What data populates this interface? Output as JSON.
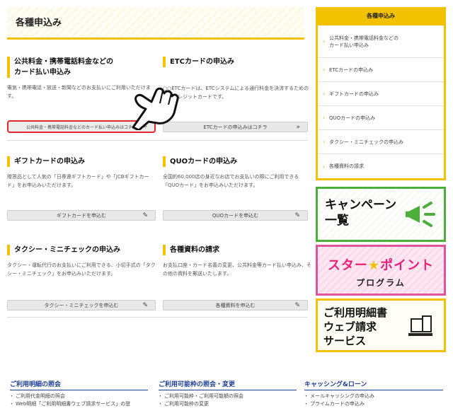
{
  "header": {
    "title": "各種申込み"
  },
  "cards": [
    {
      "title": "公共料金・携帯電話料金などの\nカード払い申込み",
      "desc": "電気・携帯電話・放送・新聞などのお支払いにご利用いただけます。",
      "button": "公共料金・携帯電話料金などのカード払い申込みはコチラ",
      "icon": "double-chevron-right"
    },
    {
      "title": "ETCカードの申込み",
      "desc": "○○ETCカードは、ETCシステムによる通行料金を決済するための専用クレジットカードです。",
      "button": "ETCカードの申込みはコチラ",
      "icon": "double-chevron-right"
    },
    {
      "title": "ギフトカードの申込み",
      "desc": "贈答品として人気の「日専連ギフトカード」や「JCBギフトカード」をお申込みいただけます。",
      "button": "ギフトカードを申込む",
      "icon": "pencil-square"
    },
    {
      "title": "QUOカードの申込み",
      "desc": "全国約60,000店の身近なお店でお支払いの際にご利用できる「QUOカード」をお申込みいただけます。",
      "button": "QUOカードを申込む",
      "icon": "pencil-square"
    },
    {
      "title": "タクシー・ミニチェックの申込み",
      "desc": "タクシー・運転代行のお支払いにご利用できる、小切手式の「タクシー・ミニチェック」をお申込みいただけます。",
      "button": "タクシー・ミニチェックを申込む",
      "icon": "pencil-square"
    },
    {
      "title": "各種資料の請求",
      "desc": "お支払口座・カード名義の変更、公共料金等カード払い申込み、その他の資料を郵送いたします。",
      "button": "各種資料を申込む",
      "icon": "pencil-square"
    }
  ],
  "sidebar": {
    "title": "各種申込み",
    "items": [
      "公共料金・携帯電話料金などの\nカード払い申込み",
      "ETCカードの申込み",
      "ギフトカードの申込み",
      "QUOカードの申込み",
      "タクシー・ミニチェックの申込み",
      "各種資料の請求"
    ]
  },
  "banners": {
    "campaign": "キャンペーン\n一覧",
    "star_point_line1_a": "スター",
    "star_point_line1_b": "ポイント",
    "star_point_line2": "プログラム",
    "web_statement": "ご利用明細書\nウェブ請求\nサービス"
  },
  "footer": [
    {
      "title": "ご利用明細の照会",
      "items": [
        "ご利用代金明細の照会",
        "Web明細「ご利用明細書ウェブ請求サービス」の登"
      ]
    },
    {
      "title": "ご利用可能枠の照会・変更",
      "items": [
        "ご利用可能枠・ご利用可能額の照会",
        "ご利用可能枠の変更"
      ]
    },
    {
      "title": "キャッシング&ローン",
      "items": [
        "メールキャッシングの申込み",
        "プライムカードの申込み"
      ]
    }
  ],
  "colors": {
    "accent": "#f2c200",
    "highlight": "#e3262e",
    "link": "#1c3f94",
    "green": "#4caf3a",
    "pink": "#e0559a"
  }
}
